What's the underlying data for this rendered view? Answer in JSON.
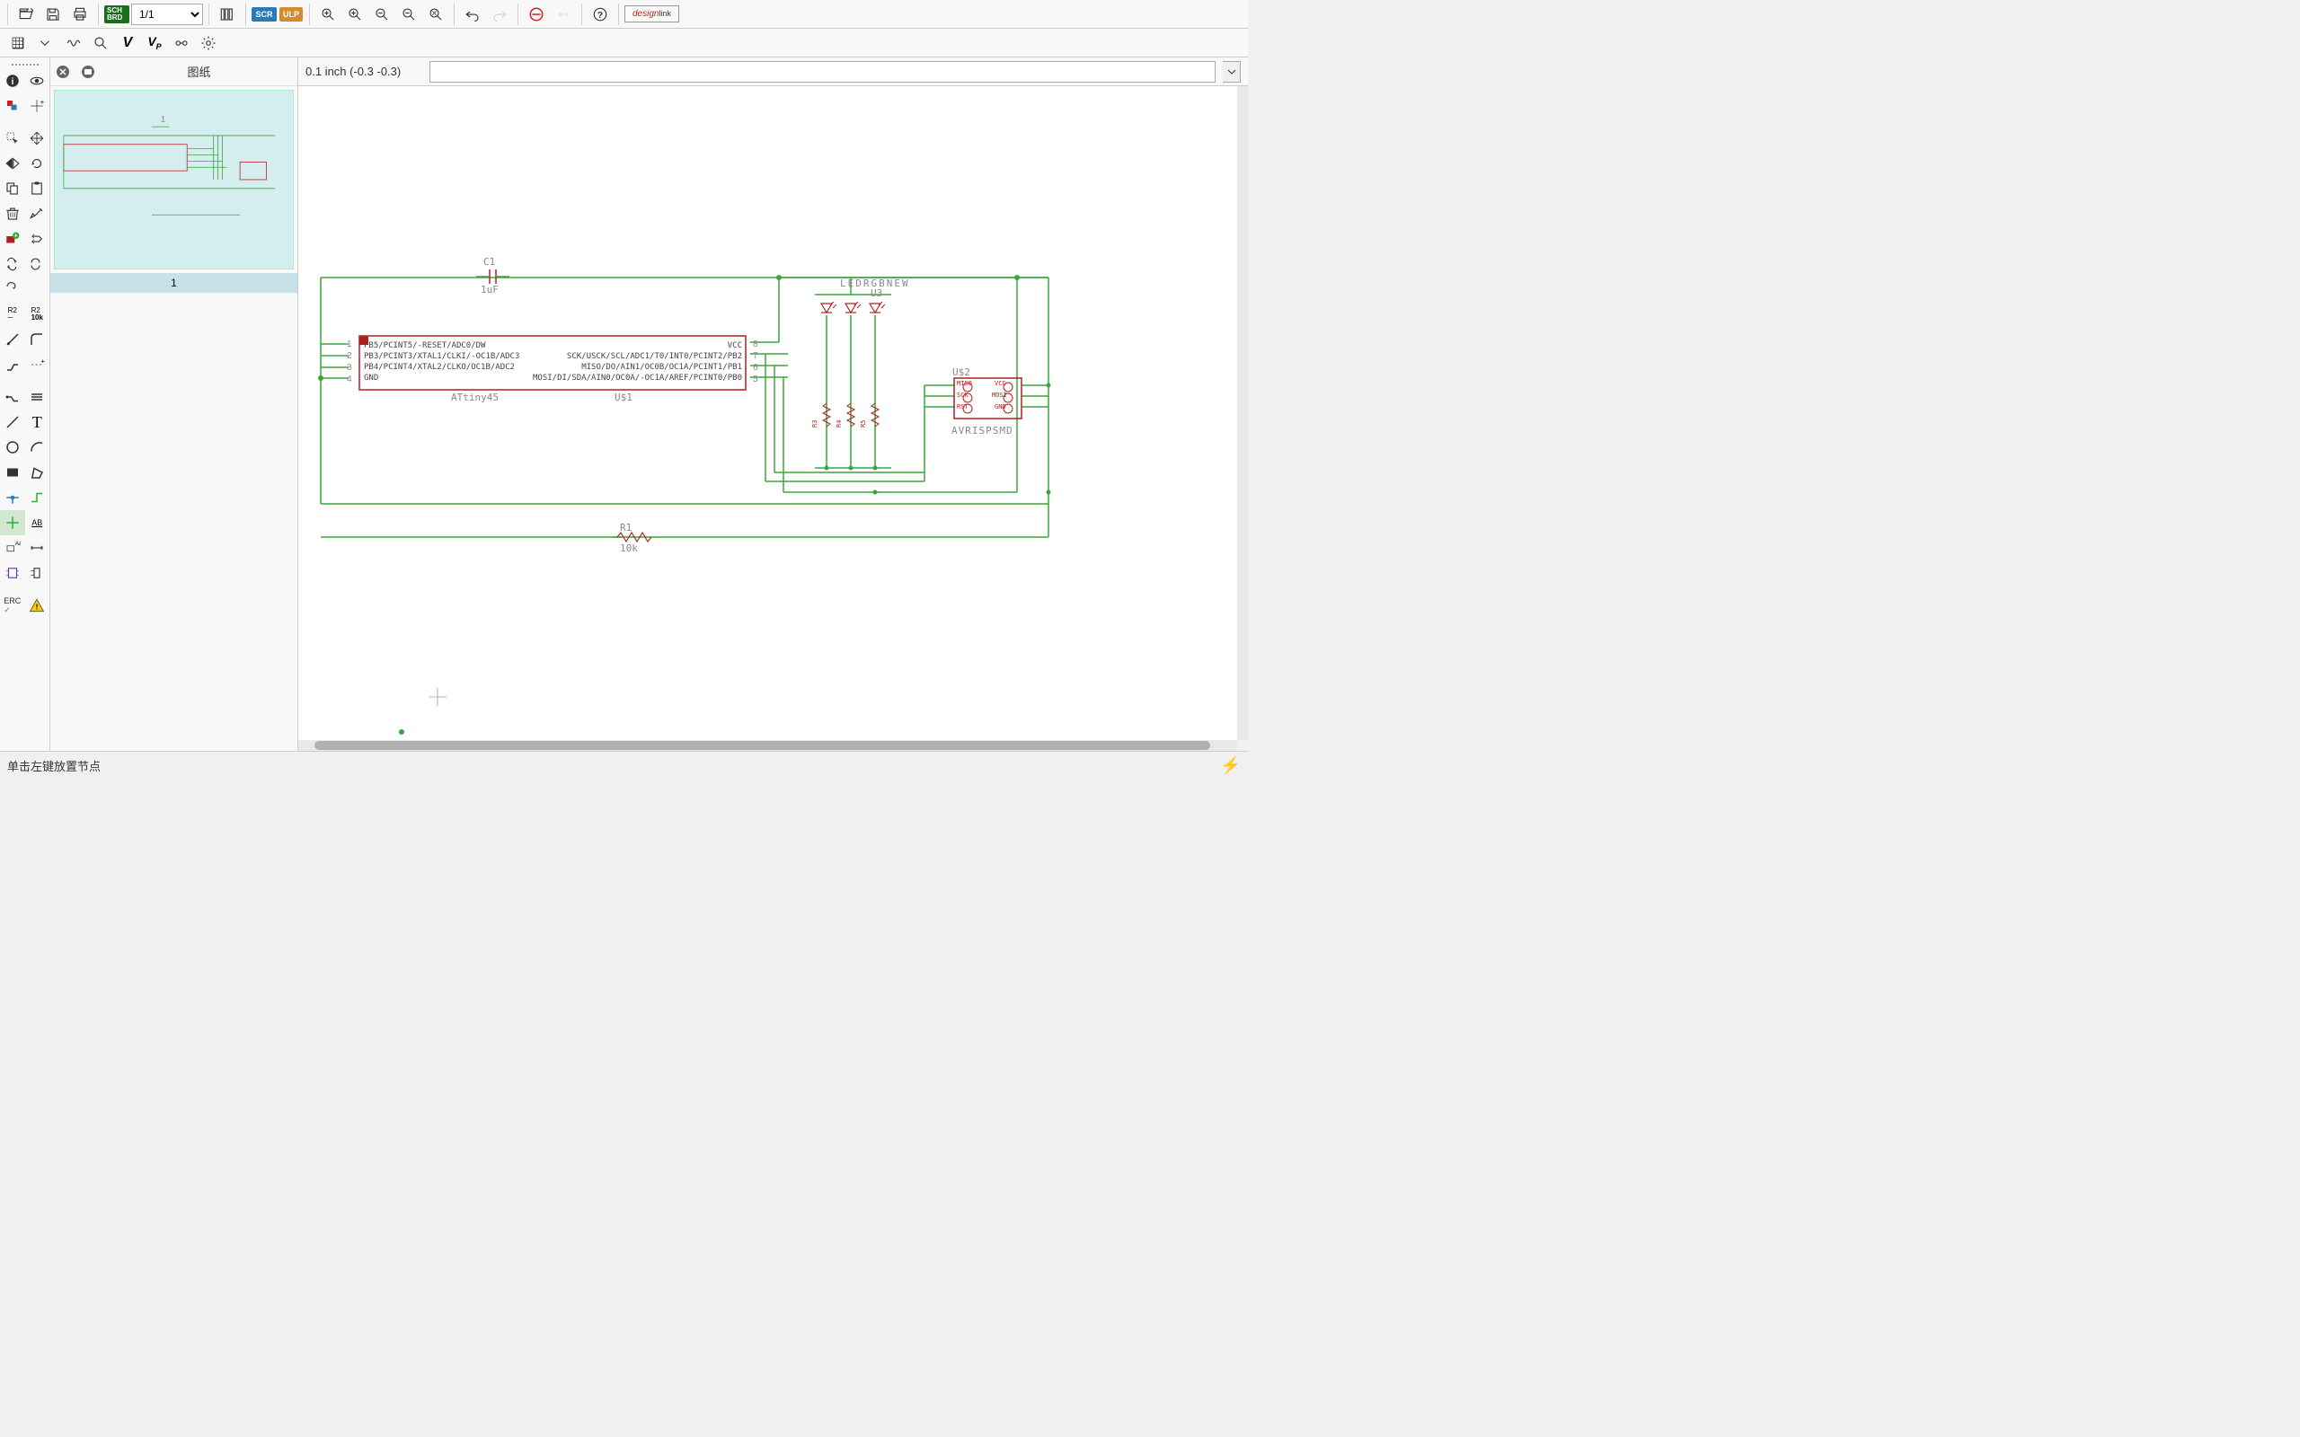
{
  "toolbar": {
    "page_value": "1/1",
    "scr_label": "SCR",
    "ulp_label": "ULP",
    "brd_label": "SCH\nBRD",
    "design_link_1": "design",
    "design_link_2": "link"
  },
  "coord": {
    "text": "0.1 inch (-0.3 -0.3)"
  },
  "sheet": {
    "title": "图纸",
    "label": "1"
  },
  "status": {
    "msg": "单击左键放置节点"
  },
  "schematic": {
    "c1_name": "C1",
    "c1_value": "1uF",
    "ic_part": "ATtiny45",
    "ic_ref": "U$1",
    "ic_pins_left": [
      {
        "num": "1",
        "name": "PB5/PCINT5/-RESET/ADC0/DW"
      },
      {
        "num": "2",
        "name": "PB3/PCINT3/XTAL1/CLKI/-OC1B/ADC3"
      },
      {
        "num": "3",
        "name": "PB4/PCINT4/XTAL2/CLKO/OC1B/ADC2"
      },
      {
        "num": "4",
        "name": "GND"
      }
    ],
    "ic_pins_right": [
      {
        "num": "8",
        "name": "VCC"
      },
      {
        "num": "7",
        "name": "SCK/USCK/SCL/ADC1/T0/INT0/PCINT2/PB2"
      },
      {
        "num": "6",
        "name": "MISO/DO/AIN1/OC0B/OC1A/PCINT1/PB1"
      },
      {
        "num": "5",
        "name": "MOSI/DI/SDA/AIN0/OC0A/-OC1A/AREF/PCINT0/PB0"
      }
    ],
    "r1_name": "R1",
    "r1_value": "10k",
    "led_name": "LEDRGBNEW",
    "led_ref": "U3",
    "isp_ref": "U$2",
    "isp_name": "AVRISPSMD",
    "isp_pins": [
      "MISO",
      "VCC",
      "SCK",
      "MOSI",
      "RST",
      "GND"
    ],
    "res_refs": [
      "R3",
      "R4",
      "R5"
    ]
  }
}
